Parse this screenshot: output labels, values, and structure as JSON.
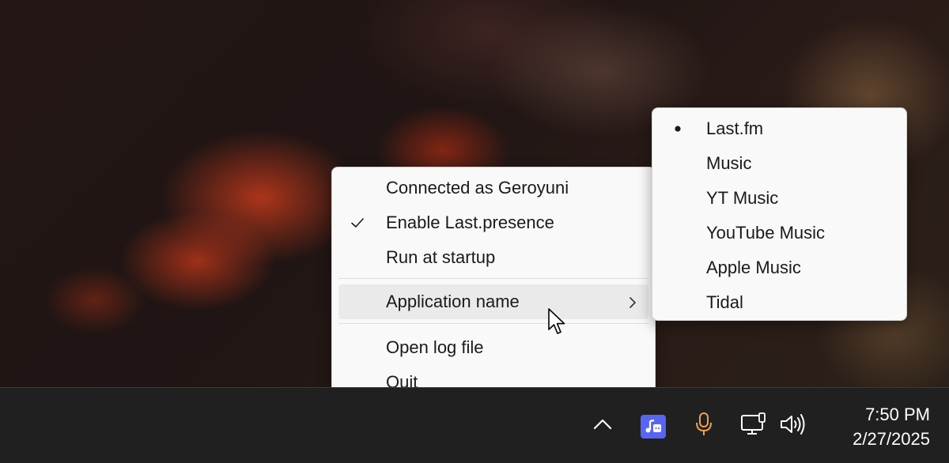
{
  "main_menu": {
    "items": [
      {
        "label": "Connected as Geroyuni",
        "checked": false
      },
      {
        "label": "Enable Last.presence",
        "checked": true
      },
      {
        "label": "Run at startup",
        "checked": false
      },
      {
        "label": "Application name",
        "has_submenu": true,
        "highlighted": true
      },
      {
        "label": "Open log file"
      },
      {
        "label": "Quit"
      }
    ]
  },
  "submenu": {
    "items": [
      {
        "label": "Last.fm",
        "selected": true
      },
      {
        "label": "Music"
      },
      {
        "label": "YT Music"
      },
      {
        "label": "YouTube Music"
      },
      {
        "label": "Apple Music"
      },
      {
        "label": "Tidal"
      }
    ]
  },
  "taskbar": {
    "tray_icons": [
      "chevron-up-icon",
      "lastpresence-app-icon",
      "microphone-icon",
      "network-icon",
      "speaker-icon"
    ],
    "clock": {
      "time": "7:50 PM",
      "date": "2/27/2025"
    }
  },
  "colors": {
    "app_icon_bg": "#5865f2",
    "mic_icon": "#f0a050",
    "menu_bg": "#f9f9f9",
    "taskbar_bg": "#202020"
  }
}
